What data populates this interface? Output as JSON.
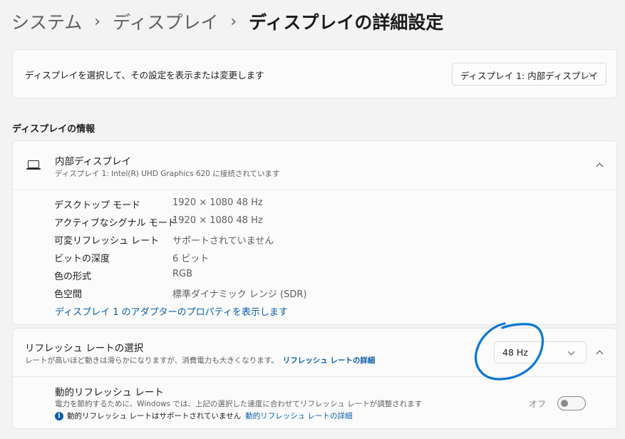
{
  "breadcrumb": {
    "items": [
      "システム",
      "ディスプレイ"
    ],
    "current": "ディスプレイの詳細設定",
    "separator": "›"
  },
  "display_select": {
    "label": "ディスプレイを選択して、その設定を表示または変更します",
    "dropdown_value": "ディスプレイ 1: 内部ディスプレイ"
  },
  "section_title": "ディスプレイの情報",
  "display_info": {
    "title": "内部ディスプレイ",
    "subtitle": "ディスプレイ 1: Intel(R) UHD Graphics 620 に接続されています",
    "icon": "laptop-icon",
    "specs": [
      {
        "name": "デスクトップ モード",
        "value": "1920 × 1080 48 Hz"
      },
      {
        "name": "アクティブなシグナル モード",
        "value": "1920 × 1080 48 Hz"
      },
      {
        "name": "可変リフレッシュ レート",
        "value": "サポートされていません"
      },
      {
        "name": "ビットの深度",
        "value": "6 ビット"
      },
      {
        "name": "色の形式",
        "value": "RGB"
      },
      {
        "name": "色空間",
        "value": "標準ダイナミック レンジ (SDR)"
      }
    ],
    "adapter_link": "ディスプレイ 1 のアダプターのプロパティを表示します"
  },
  "refresh_rate": {
    "title": "リフレッシュ レートの選択",
    "subtitle": "レートが高いほど動きは滑らかになりますが、消費電力も大きくなります。",
    "details_link": "リフレッシュ レートの詳細",
    "dropdown_value": "48 Hz",
    "dynamic": {
      "title": "動的リフレッシュ レート",
      "subtitle": "電力を節約するために、Windows では、上記の選択した速度に合わせてリフレッシュ レートが調整されます",
      "note": "動的リフレッシュ レートはサポートされていません",
      "note_link": "動的リフレッシュ レートの詳細",
      "toggle_label": "オフ",
      "toggle_on": false
    }
  },
  "colors": {
    "accent": "#0a5da8",
    "annotation_circle": "#0a77d4",
    "background": "#f3f3f3",
    "card": "#fbfbfb"
  }
}
